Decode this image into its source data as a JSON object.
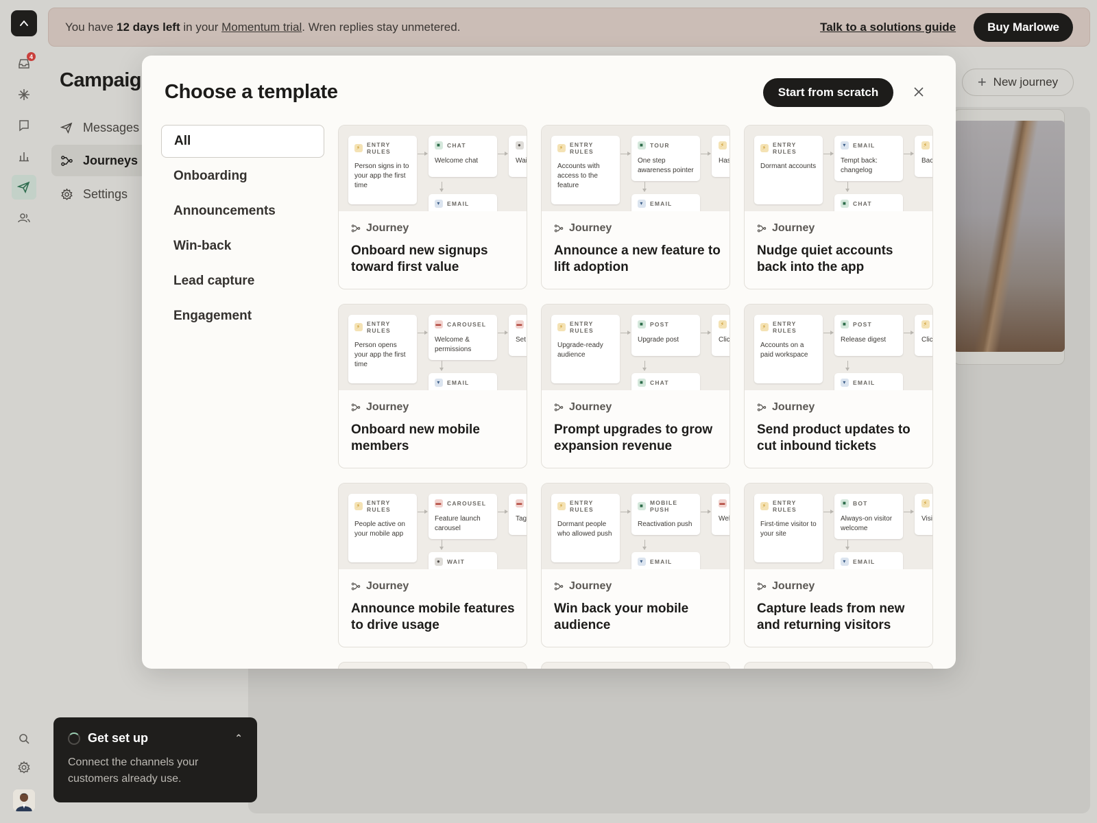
{
  "banner": {
    "prefix": "You have ",
    "days": "12 days left",
    "middle": " in your ",
    "trial_link": "Momentum trial",
    "suffix": ". Wren replies stay unmetered.",
    "guide_link": "Talk to a solutions guide",
    "buy_button": "Buy Marlowe"
  },
  "rail": {
    "inbox_badge": "4",
    "icons": [
      "logo-icon",
      "inbox-icon",
      "sparkle-icon",
      "chat-icon",
      "reports-icon",
      "campaigns-icon",
      "people-icon",
      "search-icon",
      "gear-icon",
      "avatar"
    ]
  },
  "page": {
    "title": "Campaigns",
    "nav": [
      {
        "label": "Messages",
        "icon": "send-icon"
      },
      {
        "label": "Journeys",
        "icon": "journey-icon",
        "active": true
      },
      {
        "label": "Settings",
        "icon": "gear-icon"
      }
    ],
    "new_journey": "New journey"
  },
  "setup": {
    "title": "Get set up",
    "body": "Connect the channels your customers already use."
  },
  "modal": {
    "title": "Choose a template",
    "scratch_button": "Start from scratch",
    "categories": [
      "All",
      "Onboarding",
      "Announcements",
      "Win-back",
      "Lead capture",
      "Engagement"
    ],
    "active_category": "All",
    "cards": [
      {
        "kind": "Journey",
        "title": "Onboard new signups toward first value",
        "entry": {
          "label": "ENTRY RULES",
          "text": "Person signs in to your app the first time"
        },
        "step": {
          "label": "CHAT",
          "color": "g",
          "text": "Welcome chat"
        },
        "next": {
          "text": "Wai",
          "color": "k"
        },
        "below": {
          "label": "EMAIL",
          "color": "b"
        }
      },
      {
        "kind": "Journey",
        "title": "Announce a new feature to lift adoption",
        "entry": {
          "label": "ENTRY RULES",
          "text": "Accounts with access to the feature"
        },
        "step": {
          "label": "TOUR",
          "color": "g",
          "text": "One step awareness pointer"
        },
        "next": {
          "text": "Has",
          "color": "y"
        },
        "below": {
          "label": "EMAIL",
          "color": "b"
        }
      },
      {
        "kind": "Journey",
        "title": "Nudge quiet accounts back into the app",
        "entry": {
          "label": "ENTRY RULES",
          "text": "Dormant accounts"
        },
        "step": {
          "label": "EMAIL",
          "color": "b",
          "text": "Tempt back: changelog"
        },
        "next": {
          "text": "Bac",
          "color": "y"
        },
        "below": {
          "label": "CHAT",
          "color": "g"
        }
      },
      {
        "kind": "Journey",
        "title": "Onboard new mobile members",
        "entry": {
          "label": "ENTRY RULES",
          "text": "Person opens your app the first time"
        },
        "step": {
          "label": "CAROUSEL",
          "color": "r",
          "text": "Welcome & permissions"
        },
        "next": {
          "text": "Set",
          "color": "r"
        },
        "below": {
          "label": "EMAIL",
          "color": "b"
        }
      },
      {
        "kind": "Journey",
        "title": "Prompt upgrades to grow expansion revenue",
        "entry": {
          "label": "ENTRY RULES",
          "text": "Upgrade-ready audience"
        },
        "step": {
          "label": "POST",
          "color": "g",
          "text": "Upgrade post"
        },
        "next": {
          "text": "Clic",
          "color": "y"
        },
        "below": {
          "label": "CHAT",
          "color": "g"
        }
      },
      {
        "kind": "Journey",
        "title": "Send product updates to cut inbound tickets",
        "entry": {
          "label": "ENTRY RULES",
          "text": "Accounts on a paid workspace"
        },
        "step": {
          "label": "POST",
          "color": "g",
          "text": "Release digest"
        },
        "next": {
          "text": "Clic",
          "color": "y"
        },
        "below": {
          "label": "EMAIL",
          "color": "b"
        }
      },
      {
        "kind": "Journey",
        "title": "Announce mobile features to drive usage",
        "entry": {
          "label": "ENTRY RULES",
          "text": "People active on your mobile app"
        },
        "step": {
          "label": "CAROUSEL",
          "color": "r",
          "text": "Feature launch carousel"
        },
        "next": {
          "text": "Tag",
          "color": "r"
        },
        "below": {
          "label": "WAIT",
          "color": "k"
        }
      },
      {
        "kind": "Journey",
        "title": "Win back your mobile audience",
        "entry": {
          "label": "ENTRY RULES",
          "text": "Dormant people who allowed push"
        },
        "step": {
          "label": "MOBILE PUSH",
          "color": "g",
          "text": "Reactivation push"
        },
        "next": {
          "text": "Wel",
          "color": "r"
        },
        "below": {
          "label": "EMAIL",
          "color": "b"
        }
      },
      {
        "kind": "Journey",
        "title": "Capture leads from new and returning visitors",
        "entry": {
          "label": "ENTRY RULES",
          "text": "First-time visitor to your site"
        },
        "step": {
          "label": "BOT",
          "color": "g",
          "text": "Always-on visitor welcome"
        },
        "next": {
          "text": "Visi",
          "color": "y"
        },
        "below": {
          "label": "EMAIL",
          "color": "b"
        }
      }
    ]
  }
}
